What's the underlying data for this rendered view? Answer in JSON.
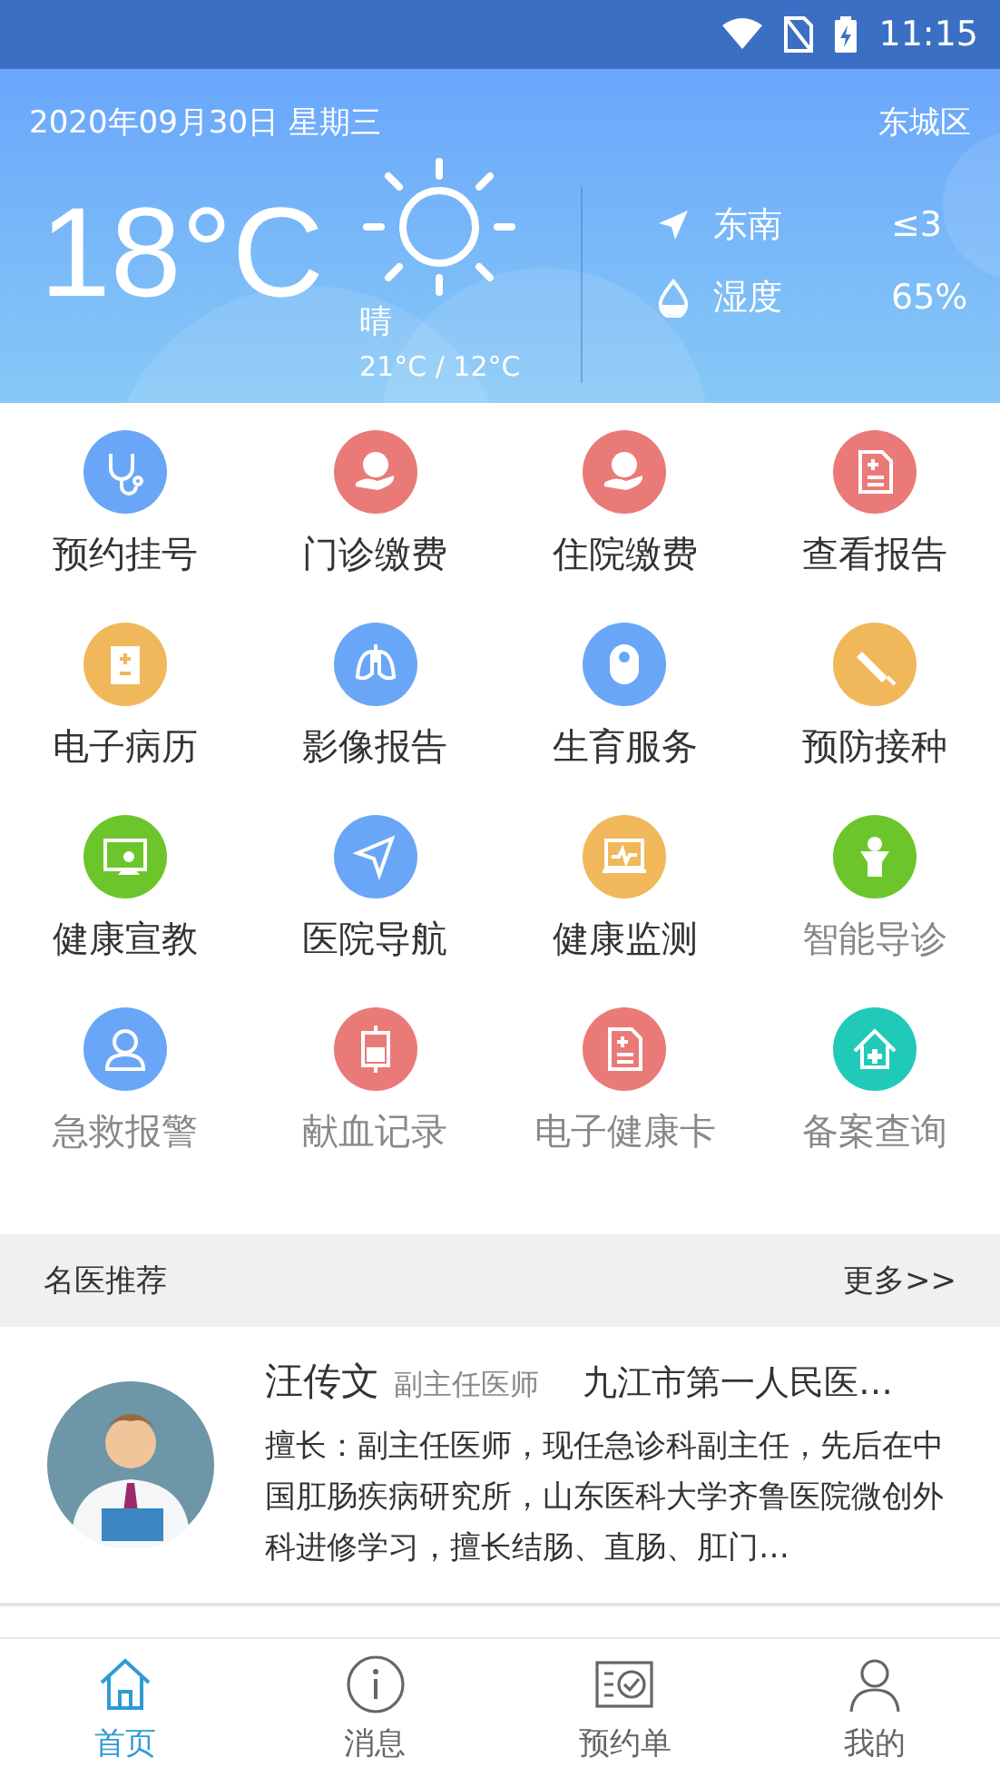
{
  "status_bar": {
    "time": "11:15"
  },
  "weather": {
    "date": "2020年09月30日 星期三",
    "district": "东城区",
    "temperature": "18°C",
    "condition": "晴",
    "range": "21°C / 12°C",
    "wind_direction": "东南",
    "wind_level": "≤3",
    "humidity_label": "湿度",
    "humidity": "65%"
  },
  "services": [
    {
      "label": "预约挂号",
      "color": "#6aa6f8",
      "disabled": false
    },
    {
      "label": "门诊缴费",
      "color": "#ea7a78",
      "disabled": false
    },
    {
      "label": "住院缴费",
      "color": "#ea7a78",
      "disabled": false
    },
    {
      "label": "查看报告",
      "color": "#ea7a78",
      "disabled": false
    },
    {
      "label": "电子病历",
      "color": "#f0b85a",
      "disabled": false
    },
    {
      "label": "影像报告",
      "color": "#6aa6f8",
      "disabled": false
    },
    {
      "label": "生育服务",
      "color": "#6aa6f8",
      "disabled": false
    },
    {
      "label": "预防接种",
      "color": "#f0b85a",
      "disabled": false
    },
    {
      "label": "健康宣教",
      "color": "#6cc52a",
      "disabled": false
    },
    {
      "label": "医院导航",
      "color": "#6aa6f8",
      "disabled": false
    },
    {
      "label": "健康监测",
      "color": "#f0b85a",
      "disabled": false
    },
    {
      "label": "智能导诊",
      "color": "#6cc52a",
      "disabled": true
    },
    {
      "label": "急救报警",
      "color": "#6aa6f8",
      "disabled": true
    },
    {
      "label": "献血记录",
      "color": "#ea7a78",
      "disabled": true
    },
    {
      "label": "电子健康卡",
      "color": "#ea7a78",
      "disabled": true
    },
    {
      "label": "备案查询",
      "color": "#21c9b8",
      "disabled": true
    }
  ],
  "section": {
    "title": "名医推荐",
    "more": "更多>>"
  },
  "doctors": [
    {
      "name": "汪传文",
      "title": "副主任医师",
      "hospital": "九江市第一人民医…",
      "bio": "擅长：副主任医师，现任急诊科副主任，先后在中国肛肠疾病研究所，山东医科大学齐鲁医院微创外科进修学习，擅长结肠、直肠、肛门…"
    }
  ],
  "tab_bar": [
    {
      "label": "首页",
      "selected": true
    },
    {
      "label": "消息",
      "selected": false
    },
    {
      "label": "预约单",
      "selected": false
    },
    {
      "label": "我的",
      "selected": false
    }
  ]
}
